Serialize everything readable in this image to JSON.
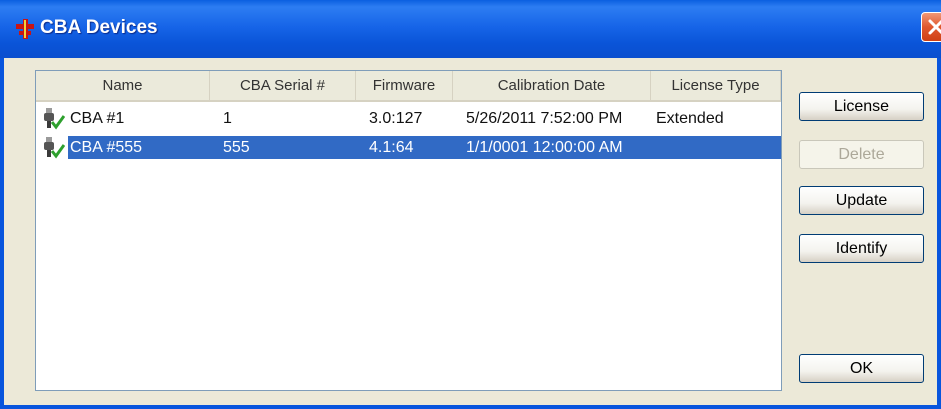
{
  "window": {
    "title": "CBA Devices"
  },
  "columns": [
    "Name",
    "CBA Serial #",
    "Firmware",
    "Calibration Date",
    "License Type"
  ],
  "devices": [
    {
      "name": "CBA #1",
      "serial": "1",
      "firmware": "3.0:127",
      "calibration_date": "5/26/2011 7:52:00 PM",
      "license_type": "Extended",
      "selected": false
    },
    {
      "name": "CBA #555",
      "serial": "555",
      "firmware": "4.1:64",
      "calibration_date": "1/1/0001 12:00:00 AM",
      "license_type": "",
      "selected": true
    }
  ],
  "buttons": {
    "license": "License",
    "delete": "Delete",
    "update": "Update",
    "identify": "Identify",
    "ok": "OK"
  },
  "colors": {
    "titlebar": "#0a54d8",
    "selection": "#316ac5",
    "close_button": "#e0582e"
  },
  "icons": {
    "app": "cba-app-icon",
    "device": "usb-device-check-icon",
    "close": "close-icon"
  }
}
